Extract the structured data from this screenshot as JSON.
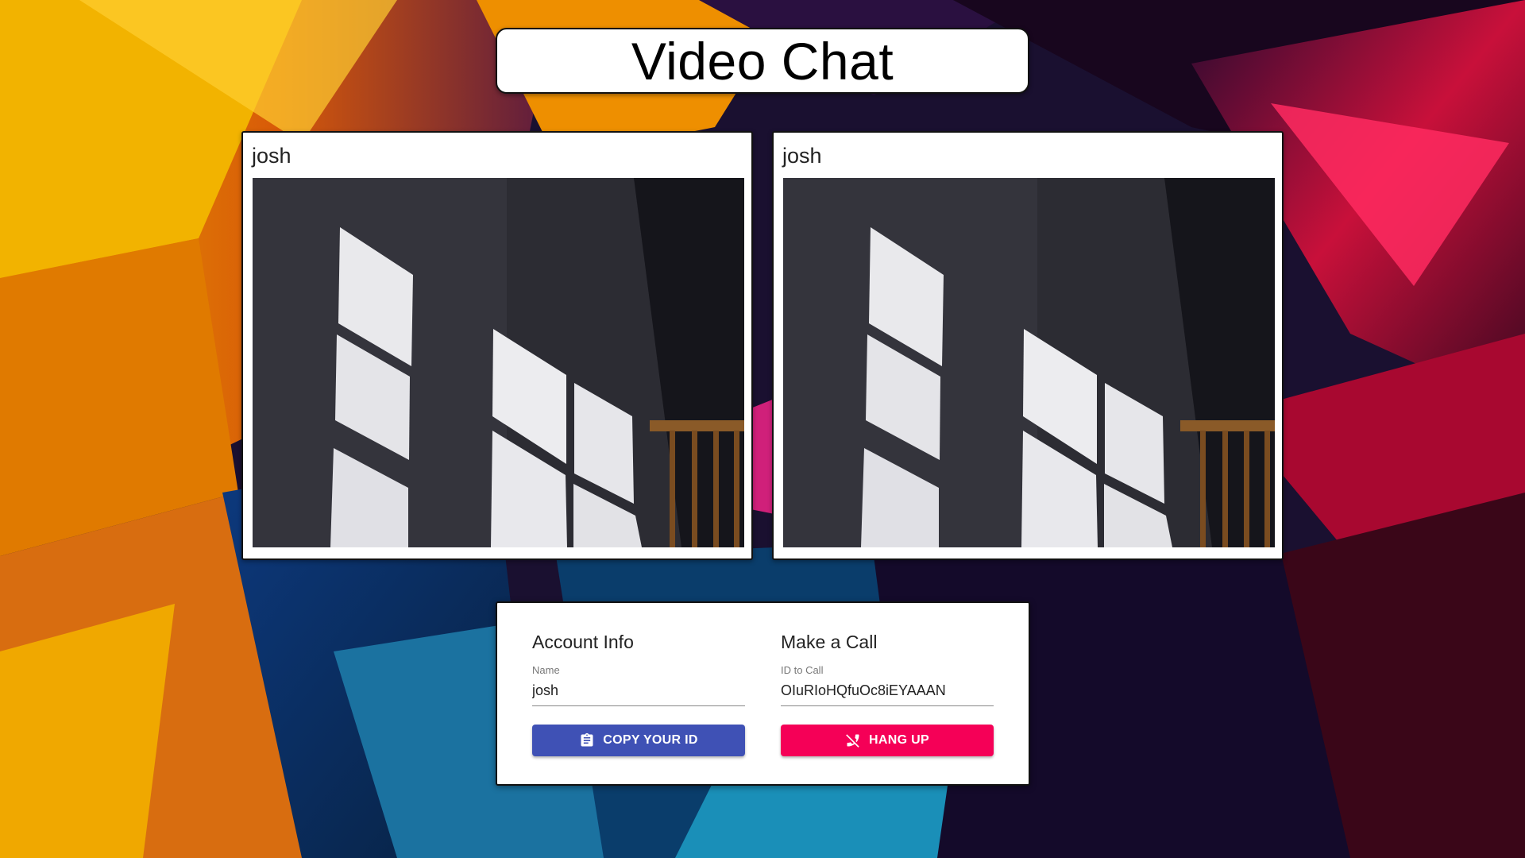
{
  "app": {
    "title": "Video Chat"
  },
  "videos": [
    {
      "name": "josh"
    },
    {
      "name": "josh"
    }
  ],
  "account": {
    "heading": "Account Info",
    "name_label": "Name",
    "name_value": "josh",
    "copy_button": "COPY YOUR ID",
    "copy_icon": "clipboard-icon"
  },
  "call": {
    "heading": "Make a Call",
    "id_label": "ID to Call",
    "id_value": "OIuRIoHQfuOc8iEYAAAN",
    "hangup_button": "HANG UP",
    "hangup_icon": "phone-disabled-icon"
  },
  "colors": {
    "primary": "#3f51b5",
    "secondary": "#f50057"
  }
}
